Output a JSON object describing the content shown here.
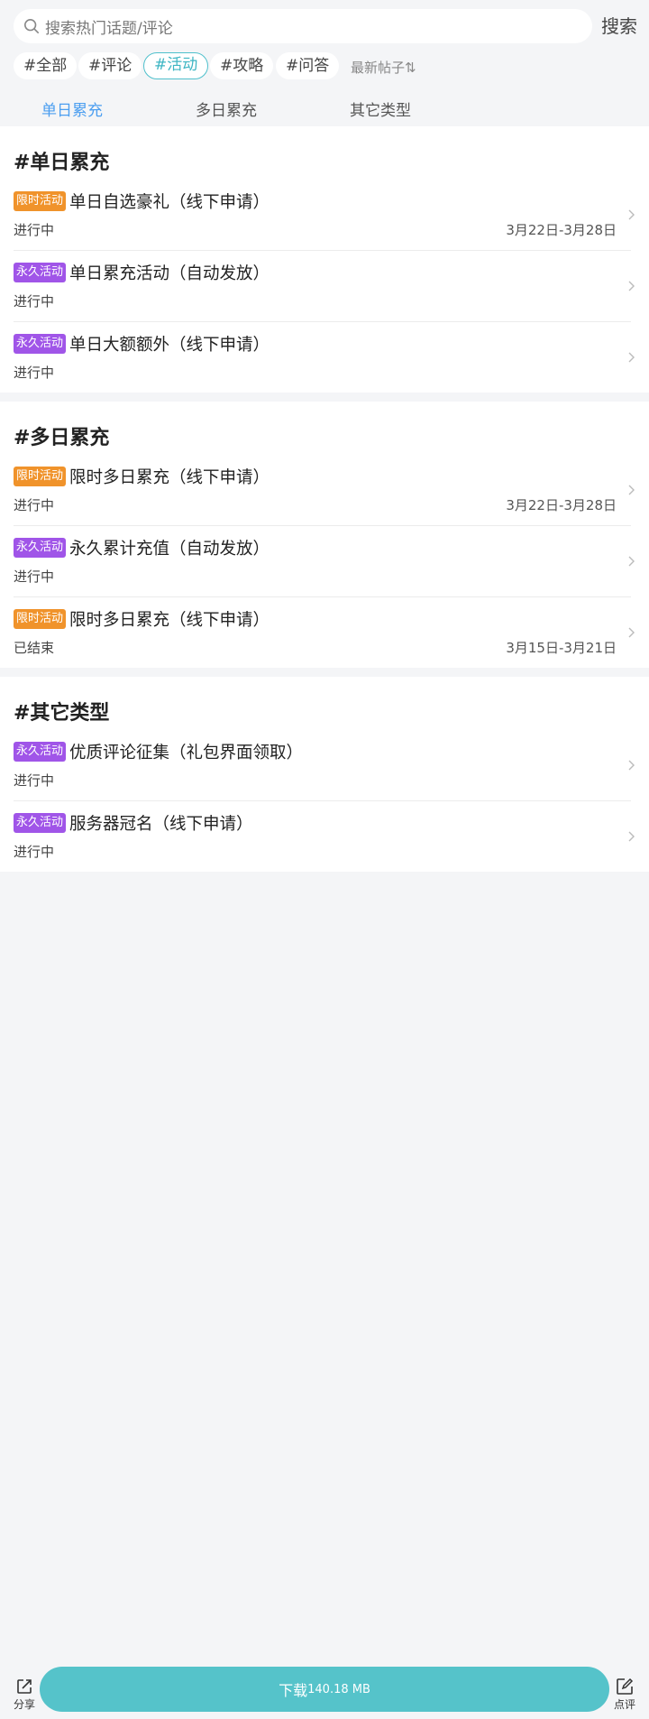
{
  "search": {
    "placeholder": "搜索热门话题/评论",
    "button_label": "搜索"
  },
  "chips": [
    "#全部",
    "#评论",
    "#活动",
    "#攻略",
    "#问答"
  ],
  "active_chip_index": 2,
  "sort_label": "最新帖子⇅",
  "tabs": [
    "单日累充",
    "多日累充",
    "其它类型"
  ],
  "active_tab_index": 0,
  "sections": [
    {
      "title": "#单日累充",
      "items": [
        {
          "badge": "限时活动",
          "badge_color": "#f0932b",
          "title": "单日自选豪礼（线下申请）",
          "status": "进行中",
          "date": "3月22日-3月28日"
        },
        {
          "badge": "永久活动",
          "badge_color": "#a055e8",
          "title": "单日累充活动（自动发放）",
          "status": "进行中",
          "date": ""
        },
        {
          "badge": "永久活动",
          "badge_color": "#a055e8",
          "title": "单日大额额外（线下申请）",
          "status": "进行中",
          "date": ""
        }
      ]
    },
    {
      "title": "#多日累充",
      "items": [
        {
          "badge": "限时活动",
          "badge_color": "#f0932b",
          "title": "限时多日累充（线下申请）",
          "status": "进行中",
          "date": "3月22日-3月28日"
        },
        {
          "badge": "永久活动",
          "badge_color": "#a055e8",
          "title": "永久累计充值（自动发放）",
          "status": "进行中",
          "date": ""
        },
        {
          "badge": "限时活动",
          "badge_color": "#f0932b",
          "title": "限时多日累充（线下申请）",
          "status": "已结束",
          "date": "3月15日-3月21日"
        }
      ]
    },
    {
      "title": "#其它类型",
      "items": [
        {
          "badge": "永久活动",
          "badge_color": "#a055e8",
          "title": "优质评论征集（礼包界面领取）",
          "status": "进行中",
          "date": ""
        },
        {
          "badge": "永久活动",
          "badge_color": "#a055e8",
          "title": "服务器冠名（线下申请）",
          "status": "进行中",
          "date": ""
        }
      ]
    }
  ],
  "bottom": {
    "share_label": "分享",
    "download_label": "下载",
    "download_size": "140.18 MB",
    "review_label": "点评"
  },
  "colors": {
    "accent": "#55c3ca",
    "tab_active": "#4b9ef0",
    "limited_badge": "#f0932b",
    "permanent_badge": "#a055e8"
  }
}
